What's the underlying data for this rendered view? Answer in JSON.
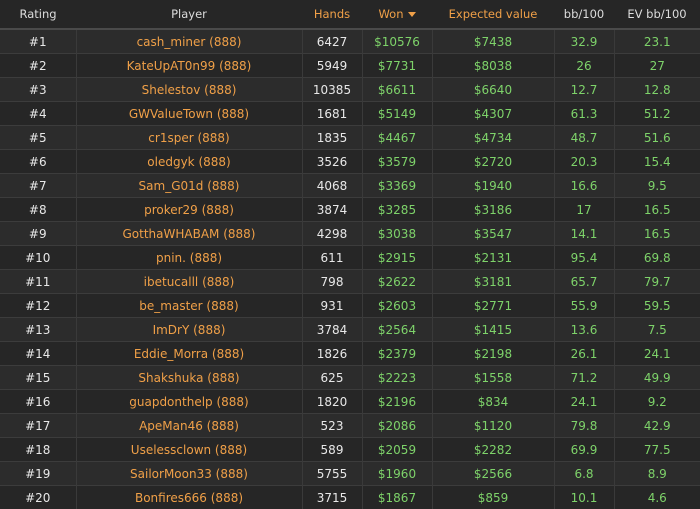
{
  "table": {
    "headers": {
      "rating": "Rating",
      "player": "Player",
      "hands": "Hands",
      "won": "Won",
      "expected_value": "Expected value",
      "bb100": "bb/100",
      "ev_bb100": "EV bb/100"
    },
    "sort": {
      "column": "won",
      "direction": "desc",
      "indicator_icon": "caret-down-icon"
    },
    "colors": {
      "accent": "#f0a048",
      "positive": "#7ed36a",
      "background": "#262626",
      "row_alt": "#2c2c2c"
    },
    "rows": [
      {
        "rating": "#1",
        "player": "cash_miner (888)",
        "hands": "6427",
        "won": "$10576",
        "ev": "$7438",
        "bb100": "32.9",
        "evbb100": "23.1"
      },
      {
        "rating": "#2",
        "player": "KateUpAT0n99 (888)",
        "hands": "5949",
        "won": "$7731",
        "ev": "$8038",
        "bb100": "26",
        "evbb100": "27"
      },
      {
        "rating": "#3",
        "player": "Shelestov (888)",
        "hands": "10385",
        "won": "$6611",
        "ev": "$6640",
        "bb100": "12.7",
        "evbb100": "12.8"
      },
      {
        "rating": "#4",
        "player": "GWValueTown (888)",
        "hands": "1681",
        "won": "$5149",
        "ev": "$4307",
        "bb100": "61.3",
        "evbb100": "51.2"
      },
      {
        "rating": "#5",
        "player": "cr1sper (888)",
        "hands": "1835",
        "won": "$4467",
        "ev": "$4734",
        "bb100": "48.7",
        "evbb100": "51.6"
      },
      {
        "rating": "#6",
        "player": "oledgyk (888)",
        "hands": "3526",
        "won": "$3579",
        "ev": "$2720",
        "bb100": "20.3",
        "evbb100": "15.4"
      },
      {
        "rating": "#7",
        "player": "Sam_G01d (888)",
        "hands": "4068",
        "won": "$3369",
        "ev": "$1940",
        "bb100": "16.6",
        "evbb100": "9.5"
      },
      {
        "rating": "#8",
        "player": "proker29 (888)",
        "hands": "3874",
        "won": "$3285",
        "ev": "$3186",
        "bb100": "17",
        "evbb100": "16.5"
      },
      {
        "rating": "#9",
        "player": "GotthaWHABAM (888)",
        "hands": "4298",
        "won": "$3038",
        "ev": "$3547",
        "bb100": "14.1",
        "evbb100": "16.5"
      },
      {
        "rating": "#10",
        "player": "pnin. (888)",
        "hands": "611",
        "won": "$2915",
        "ev": "$2131",
        "bb100": "95.4",
        "evbb100": "69.8"
      },
      {
        "rating": "#11",
        "player": "ibetucalll (888)",
        "hands": "798",
        "won": "$2622",
        "ev": "$3181",
        "bb100": "65.7",
        "evbb100": "79.7"
      },
      {
        "rating": "#12",
        "player": "be_master (888)",
        "hands": "931",
        "won": "$2603",
        "ev": "$2771",
        "bb100": "55.9",
        "evbb100": "59.5"
      },
      {
        "rating": "#13",
        "player": "ImDrY (888)",
        "hands": "3784",
        "won": "$2564",
        "ev": "$1415",
        "bb100": "13.6",
        "evbb100": "7.5"
      },
      {
        "rating": "#14",
        "player": "Eddie_Morra (888)",
        "hands": "1826",
        "won": "$2379",
        "ev": "$2198",
        "bb100": "26.1",
        "evbb100": "24.1"
      },
      {
        "rating": "#15",
        "player": "Shakshuka (888)",
        "hands": "625",
        "won": "$2223",
        "ev": "$1558",
        "bb100": "71.2",
        "evbb100": "49.9"
      },
      {
        "rating": "#16",
        "player": "guapdonthelp (888)",
        "hands": "1820",
        "won": "$2196",
        "ev": "$834",
        "bb100": "24.1",
        "evbb100": "9.2"
      },
      {
        "rating": "#17",
        "player": "ApeMan46 (888)",
        "hands": "523",
        "won": "$2086",
        "ev": "$1120",
        "bb100": "79.8",
        "evbb100": "42.9"
      },
      {
        "rating": "#18",
        "player": "Uselessclown (888)",
        "hands": "589",
        "won": "$2059",
        "ev": "$2282",
        "bb100": "69.9",
        "evbb100": "77.5"
      },
      {
        "rating": "#19",
        "player": "SailorMoon33 (888)",
        "hands": "5755",
        "won": "$1960",
        "ev": "$2566",
        "bb100": "6.8",
        "evbb100": "8.9"
      },
      {
        "rating": "#20",
        "player": "Bonfires666 (888)",
        "hands": "3715",
        "won": "$1867",
        "ev": "$859",
        "bb100": "10.1",
        "evbb100": "4.6"
      }
    ]
  }
}
